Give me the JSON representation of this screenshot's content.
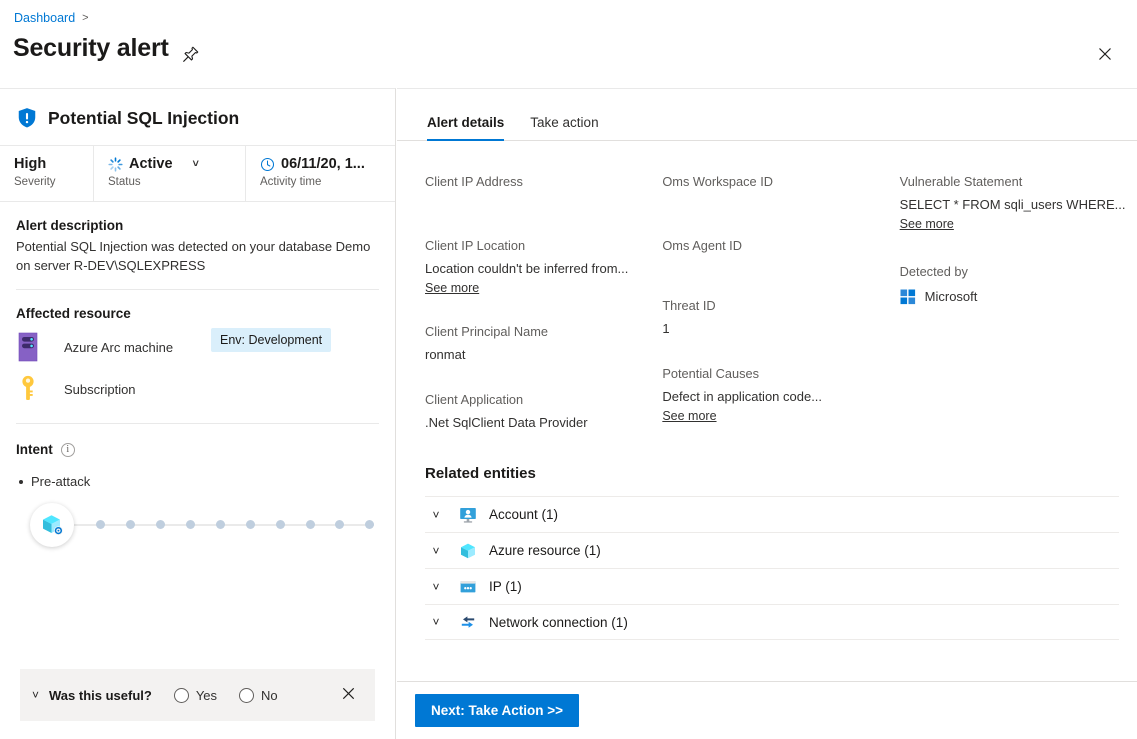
{
  "header": {
    "breadcrumb": "Dashboard",
    "breadcrumb_separator": ">",
    "title": "Security alert",
    "pin_icon": "pin-icon",
    "close_icon": "close-icon"
  },
  "left": {
    "alert_name": "Potential SQL Injection",
    "alert_icon": "shield-alert-icon",
    "status_strip": [
      {
        "value": "High",
        "label": "Severity",
        "icon": null
      },
      {
        "value": "Active",
        "label": "Status",
        "icon": "spinner-icon",
        "chevron": "chevron-down-icon"
      },
      {
        "value": "06/11/20, 1...",
        "label": "Activity time",
        "icon": "clock-icon"
      }
    ],
    "description": {
      "title": "Alert description",
      "text": "Potential SQL Injection was detected on your database Demo on server R-DEV\\SQLEXPRESS"
    },
    "affected_resource": {
      "title": "Affected resource",
      "items": [
        {
          "label": "Azure Arc machine",
          "icon": "server-icon",
          "tag": "Env: Development"
        },
        {
          "label": "Subscription",
          "icon": "key-icon",
          "tag": null
        }
      ]
    },
    "intent": {
      "title": "Intent",
      "info_icon": "info-icon",
      "stages": [
        "Pre-attack"
      ],
      "timeline_start_icon": "azure-resource-cube-icon",
      "timeline_dots": 10
    },
    "feedback": {
      "chevron": "chevron-down-icon",
      "question": "Was this useful?",
      "options": [
        "Yes",
        "No"
      ],
      "close_icon": "close-icon"
    }
  },
  "right": {
    "tabs": [
      {
        "label": "Alert details",
        "active": true
      },
      {
        "label": "Take action",
        "active": false
      }
    ],
    "detail_columns": [
      {
        "fields": [
          {
            "key": "Client IP Address",
            "value": "",
            "see_more": false,
            "tall": true
          },
          {
            "key": "Client IP Location",
            "value": "Location couldn't be inferred from...",
            "see_more": true,
            "see_more_label": "See more"
          },
          {
            "key": "Client Principal Name",
            "value": "ronmat",
            "see_more": false
          },
          {
            "key": "Client Application",
            "value": ".Net SqlClient Data Provider",
            "see_more": false
          }
        ]
      },
      {
        "fields": [
          {
            "key": "Oms Workspace ID",
            "value": "",
            "see_more": false,
            "tall": true
          },
          {
            "key": "Oms Agent ID",
            "value": "",
            "see_more": false,
            "tall": true
          },
          {
            "key": "Threat ID",
            "value": "1",
            "see_more": false
          },
          {
            "key": "Potential Causes",
            "value": "Defect in application code...",
            "see_more": true,
            "see_more_label": "See more"
          }
        ]
      },
      {
        "fields": [
          {
            "key": "Vulnerable Statement",
            "value": "SELECT * FROM sqli_users WHERE...",
            "see_more": true,
            "see_more_label": "See more"
          },
          {
            "key": "Detected by",
            "value": "Microsoft",
            "see_more": false,
            "icon": "microsoft-logo-icon"
          }
        ]
      }
    ],
    "related_entities": {
      "title": "Related entities",
      "rows": [
        {
          "label": "Account (1)",
          "icon": "account-monitor-icon",
          "chevron": "chevron-down-icon"
        },
        {
          "label": "Azure resource (1)",
          "icon": "azure-resource-cube-icon",
          "chevron": "chevron-down-icon"
        },
        {
          "label": "IP (1)",
          "icon": "ip-window-icon",
          "chevron": "chevron-down-icon"
        },
        {
          "label": "Network connection (1)",
          "icon": "network-arrows-icon",
          "chevron": "chevron-down-icon"
        }
      ]
    },
    "bottom": {
      "next_button": "Next: Take Action >>"
    }
  },
  "colors": {
    "accent": "#0078d4",
    "tag_bg": "#daeffb",
    "severity_high": "#1b1a19",
    "arc_machine": "#8661c5",
    "key": "#ffc83d"
  }
}
